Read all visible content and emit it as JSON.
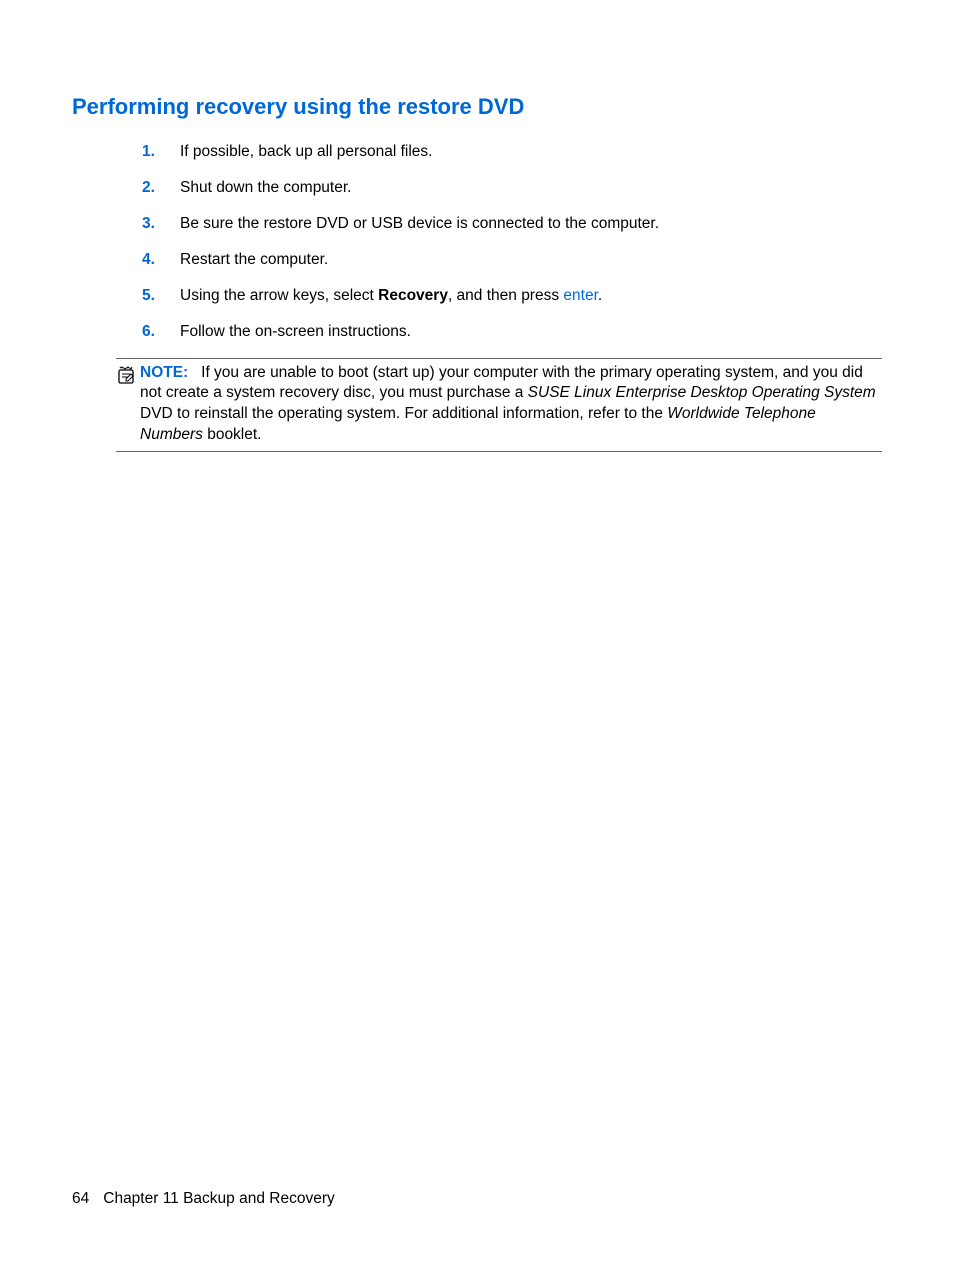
{
  "heading": "Performing recovery using the restore DVD",
  "steps": [
    {
      "num": "1.",
      "text": "If possible, back up all personal files."
    },
    {
      "num": "2.",
      "text": "Shut down the computer."
    },
    {
      "num": "3.",
      "text": "Be sure the restore DVD or USB device is connected to the computer."
    },
    {
      "num": "4.",
      "text": "Restart the computer."
    },
    {
      "num": "5.",
      "prefix": "Using the arrow keys, select ",
      "bold": "Recovery",
      "mid": ", and then press ",
      "link": "enter",
      "suffix": "."
    },
    {
      "num": "6.",
      "text": "Follow the on-screen instructions."
    }
  ],
  "note": {
    "label": "NOTE:",
    "part1": "If you are unable to boot (start up) your computer with the primary operating system, and you did not create a system recovery disc, you must purchase a ",
    "italic1": "SUSE Linux Enterprise Desktop Operating System",
    "part2": " DVD to reinstall the operating system. For additional information, refer to the ",
    "italic2": "Worldwide Telephone Numbers",
    "part3": " booklet."
  },
  "footer": {
    "page": "64",
    "chapter": "Chapter 11   Backup and Recovery"
  }
}
